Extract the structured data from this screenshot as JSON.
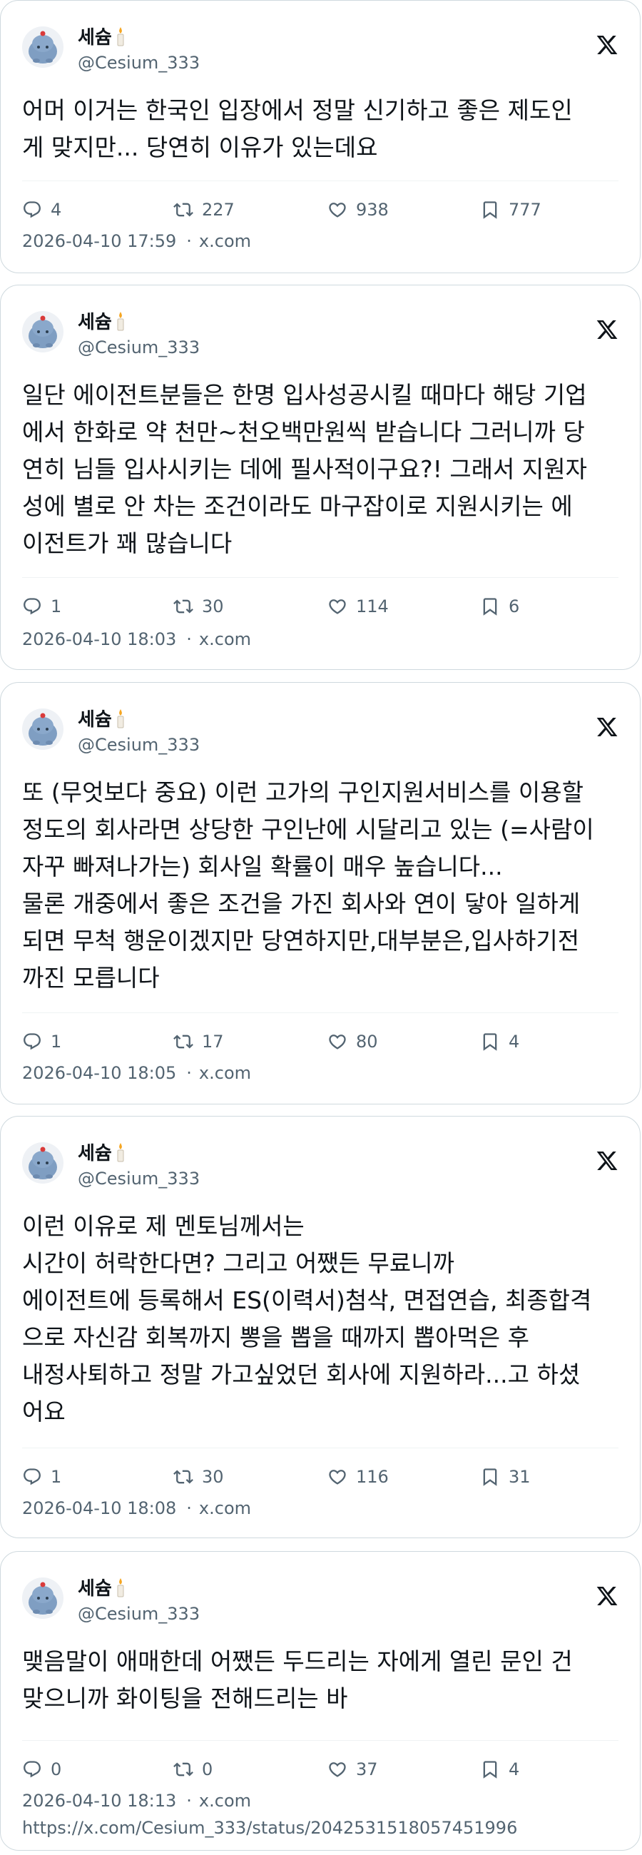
{
  "tweets": [
    {
      "display_name": "세슘",
      "username": "@Cesium_333",
      "text": "어머 이거는 한국인 입장에서 정말 신기하고 좋은 제도인\n게 맞지만... 당연히 이유가 있는데요",
      "replies": "4",
      "retweets": "227",
      "likes": "938",
      "bookmarks": "777",
      "timestamp": "2026-04-10 17:59",
      "source": "x.com"
    },
    {
      "display_name": "세슘",
      "username": "@Cesium_333",
      "text": "일단 에이전트분들은 한명 입사성공시킬 때마다 해당 기업\n에서 한화로 약 천만~천오백만원씩 받습니다 그러니까 당\n연히 님들 입사시키는 데에 필사적이구요?! 그래서 지원자\n성에 별로 안 차는 조건이라도 마구잡이로 지원시키는 에\n이전트가 꽤 많습니다",
      "replies": "1",
      "retweets": "30",
      "likes": "114",
      "bookmarks": "6",
      "timestamp": "2026-04-10 18:03",
      "source": "x.com"
    },
    {
      "display_name": "세슘",
      "username": "@Cesium_333",
      "text": "또 (무엇보다 중요) 이런 고가의 구인지원서비스를 이용할\n정도의 회사라면 상당한 구인난에 시달리고 있는 (=사람이\n자꾸 빠져나가는) 회사일 확률이 매우 높습니다...\n물론 개중에서 좋은 조건을 가진 회사와 연이 닿아 일하게\n되면 무척 행운이겠지만 당연하지만,대부분은,입사하기전\n까진 모릅니다",
      "replies": "1",
      "retweets": "17",
      "likes": "80",
      "bookmarks": "4",
      "timestamp": "2026-04-10 18:05",
      "source": "x.com"
    },
    {
      "display_name": "세슘",
      "username": "@Cesium_333",
      "text": "이런 이유로 제 멘토님께서는\n시간이 허락한다면? 그리고 어쨌든 무료니까\n에이전트에 등록해서 ES(이력서)첨삭, 면접연습, 최종합격\n으로 자신감 회복까지 뽕을 뽑을 때까지 뽑아먹은 후\n내정사퇴하고 정말 가고싶었던 회사에 지원하라...고 하셨\n어요",
      "replies": "1",
      "retweets": "30",
      "likes": "116",
      "bookmarks": "31",
      "timestamp": "2026-04-10 18:08",
      "source": "x.com"
    },
    {
      "display_name": "세슘",
      "username": "@Cesium_333",
      "text": "맺음말이 애매한데 어쨌든 두드리는 자에게 열린 문인 건\n맞으니까 화이팅을 전해드리는 바",
      "replies": "0",
      "retweets": "0",
      "likes": "37",
      "bookmarks": "4",
      "timestamp": "2026-04-10 18:13",
      "source": "x.com",
      "status_url": "https://x.com/Cesium_333/status/2042531518057451996"
    }
  ],
  "icons": {
    "avatar": "avatar-character-icon",
    "name_suffix": "candle-icon",
    "platform": "x-logo-icon",
    "reply": "reply-icon",
    "retweet": "retweet-icon",
    "like": "heart-icon",
    "bookmark": "bookmark-icon"
  },
  "colors": {
    "text": "#0f1419",
    "secondary": "#536471",
    "border": "#cfd9de",
    "avatar": "#7f9ec2"
  }
}
